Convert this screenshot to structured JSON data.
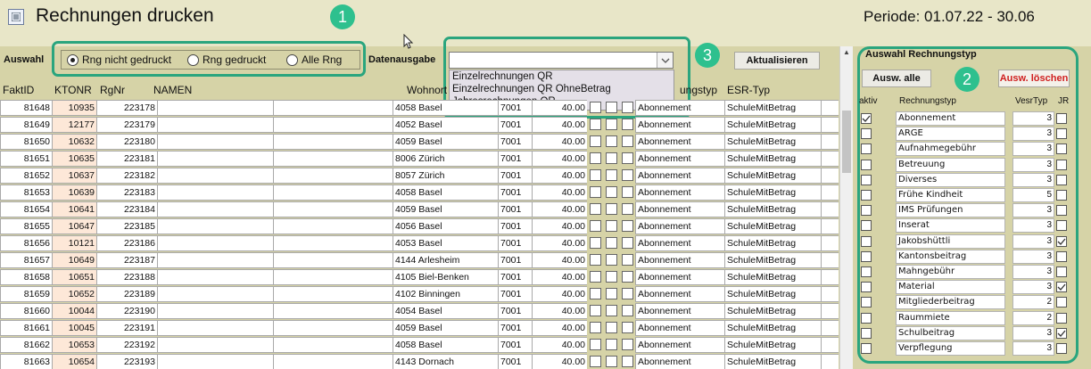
{
  "window": {
    "title": "Rechnungen drucken",
    "periode": "Periode: 01.07.22 - 30.06"
  },
  "callouts": {
    "c1": "1",
    "c2": "2",
    "c3": "3"
  },
  "filter": {
    "auswahl_label": "Auswahl",
    "radios": [
      {
        "label": "Rng nicht gedruckt",
        "checked": true
      },
      {
        "label": "Rng gedruckt",
        "checked": false
      },
      {
        "label": "Alle Rng",
        "checked": false
      }
    ],
    "datenausgabe_label": "Datenausgabe",
    "datenausgabe_value": "",
    "datenausgabe_options": [
      "Einzelrechnungen QR",
      "Einzelrechnungen QR OhneBetrag",
      "Jahresrechnungen QR"
    ],
    "refresh_label": "Aktualisieren"
  },
  "grid": {
    "headers": {
      "faktid": "FaktID",
      "ktonr": "KTONR",
      "rgnr": "RgNr",
      "namen": "NAMEN",
      "wohnort": "Wohnort",
      "rtyp": "ungstyp",
      "esr": "ESR-Typ"
    },
    "rows": [
      {
        "faktid": "81648",
        "ktonr": "10935",
        "rgnr": "223178",
        "wohnort": "4058 Basel",
        "code": "7001",
        "betrag": "40.00",
        "typ": "Abonnement",
        "esr": "SchuleMitBetrag"
      },
      {
        "faktid": "81649",
        "ktonr": "12177",
        "rgnr": "223179",
        "wohnort": "4052 Basel",
        "code": "7001",
        "betrag": "40.00",
        "typ": "Abonnement",
        "esr": "SchuleMitBetrag"
      },
      {
        "faktid": "81650",
        "ktonr": "10632",
        "rgnr": "223180",
        "wohnort": "4059 Basel",
        "code": "7001",
        "betrag": "40.00",
        "typ": "Abonnement",
        "esr": "SchuleMitBetrag"
      },
      {
        "faktid": "81651",
        "ktonr": "10635",
        "rgnr": "223181",
        "wohnort": "8006 Zürich",
        "code": "7001",
        "betrag": "40.00",
        "typ": "Abonnement",
        "esr": "SchuleMitBetrag"
      },
      {
        "faktid": "81652",
        "ktonr": "10637",
        "rgnr": "223182",
        "wohnort": "8057 Zürich",
        "code": "7001",
        "betrag": "40.00",
        "typ": "Abonnement",
        "esr": "SchuleMitBetrag"
      },
      {
        "faktid": "81653",
        "ktonr": "10639",
        "rgnr": "223183",
        "wohnort": "4058 Basel",
        "code": "7001",
        "betrag": "40.00",
        "typ": "Abonnement",
        "esr": "SchuleMitBetrag"
      },
      {
        "faktid": "81654",
        "ktonr": "10641",
        "rgnr": "223184",
        "wohnort": "4059 Basel",
        "code": "7001",
        "betrag": "40.00",
        "typ": "Abonnement",
        "esr": "SchuleMitBetrag"
      },
      {
        "faktid": "81655",
        "ktonr": "10647",
        "rgnr": "223185",
        "wohnort": "4056 Basel",
        "code": "7001",
        "betrag": "40.00",
        "typ": "Abonnement",
        "esr": "SchuleMitBetrag"
      },
      {
        "faktid": "81656",
        "ktonr": "10121",
        "rgnr": "223186",
        "wohnort": "4053 Basel",
        "code": "7001",
        "betrag": "40.00",
        "typ": "Abonnement",
        "esr": "SchuleMitBetrag"
      },
      {
        "faktid": "81657",
        "ktonr": "10649",
        "rgnr": "223187",
        "wohnort": "4144 Arlesheim",
        "code": "7001",
        "betrag": "40.00",
        "typ": "Abonnement",
        "esr": "SchuleMitBetrag"
      },
      {
        "faktid": "81658",
        "ktonr": "10651",
        "rgnr": "223188",
        "wohnort": "4105 Biel-Benken",
        "code": "7001",
        "betrag": "40.00",
        "typ": "Abonnement",
        "esr": "SchuleMitBetrag"
      },
      {
        "faktid": "81659",
        "ktonr": "10652",
        "rgnr": "223189",
        "wohnort": "4102 Binningen",
        "code": "7001",
        "betrag": "40.00",
        "typ": "Abonnement",
        "esr": "SchuleMitBetrag"
      },
      {
        "faktid": "81660",
        "ktonr": "10044",
        "rgnr": "223190",
        "wohnort": "4054 Basel",
        "code": "7001",
        "betrag": "40.00",
        "typ": "Abonnement",
        "esr": "SchuleMitBetrag"
      },
      {
        "faktid": "81661",
        "ktonr": "10045",
        "rgnr": "223191",
        "wohnort": "4059 Basel",
        "code": "7001",
        "betrag": "40.00",
        "typ": "Abonnement",
        "esr": "SchuleMitBetrag"
      },
      {
        "faktid": "81662",
        "ktonr": "10653",
        "rgnr": "223192",
        "wohnort": "4058 Basel",
        "code": "7001",
        "betrag": "40.00",
        "typ": "Abonnement",
        "esr": "SchuleMitBetrag"
      },
      {
        "faktid": "81663",
        "ktonr": "10654",
        "rgnr": "223193",
        "wohnort": "4143 Dornach",
        "code": "7001",
        "betrag": "40.00",
        "typ": "Abonnement",
        "esr": "SchuleMitBetrag"
      }
    ]
  },
  "panel": {
    "title": "Auswahl Rechnungstyp",
    "select_all_label": "Ausw. alle",
    "clear_label": "Ausw. löschen",
    "headers": {
      "aktiv": "aktiv",
      "typ": "Rechnungstyp",
      "vesr": "VesrTyp",
      "jr": "JR"
    },
    "items": [
      {
        "name": "Abonnement",
        "vesr": "3",
        "aktiv": true,
        "jr": false
      },
      {
        "name": "ARGE",
        "vesr": "3",
        "aktiv": false,
        "jr": false
      },
      {
        "name": "Aufnahmegebühr",
        "vesr": "3",
        "aktiv": false,
        "jr": false
      },
      {
        "name": "Betreuung",
        "vesr": "3",
        "aktiv": false,
        "jr": false
      },
      {
        "name": "Diverses",
        "vesr": "3",
        "aktiv": false,
        "jr": false
      },
      {
        "name": "Frühe Kindheit",
        "vesr": "5",
        "aktiv": false,
        "jr": false
      },
      {
        "name": "IMS Prüfungen",
        "vesr": "3",
        "aktiv": false,
        "jr": false
      },
      {
        "name": "Inserat",
        "vesr": "3",
        "aktiv": false,
        "jr": false
      },
      {
        "name": "Jakobshüttli",
        "vesr": "3",
        "aktiv": false,
        "jr": true
      },
      {
        "name": "Kantonsbeitrag",
        "vesr": "3",
        "aktiv": false,
        "jr": false
      },
      {
        "name": "Mahngebühr",
        "vesr": "3",
        "aktiv": false,
        "jr": false
      },
      {
        "name": "Material",
        "vesr": "3",
        "aktiv": false,
        "jr": true
      },
      {
        "name": "Mitgliederbeitrag",
        "vesr": "2",
        "aktiv": false,
        "jr": false
      },
      {
        "name": "Raummiete",
        "vesr": "2",
        "aktiv": false,
        "jr": false
      },
      {
        "name": "Schulbeitrag",
        "vesr": "3",
        "aktiv": false,
        "jr": true
      },
      {
        "name": "Verpflegung",
        "vesr": "3",
        "aktiv": false,
        "jr": false
      }
    ]
  },
  "icons": {
    "form": "form-icon",
    "dropdown": "chevron-down-icon",
    "scroll": "arrow-up-icon",
    "cursor": "mouse-pointer-icon",
    "check": "checkmark-icon"
  },
  "colors": {
    "background": "#d6d3a7",
    "callout": "#2ec08e",
    "highlight_box": "#2aa57e",
    "ktonr_cell": "#fde8d8",
    "clear_button": "#d02020"
  }
}
